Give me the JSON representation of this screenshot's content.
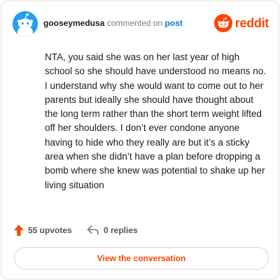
{
  "header": {
    "username": "gooseymedusa",
    "action_text": "commented on",
    "post_link": "post"
  },
  "brand": {
    "wordmark": "reddit",
    "icon": "reddit-alien-logo",
    "color": "#ff4500"
  },
  "comment": {
    "text": "NTA, you said she was on her last year of high school so she should have understood no means no. I understand why she would want to come out to her parents but ideally she should have thought about the long term rather than the short term weight lifted off her shoulders. I don’t ever condone anyone having to hide who they really are but it’s a sticky area when she didn’t have a plan before dropping a bomb where she knew was potential to shake up her living situation"
  },
  "footer": {
    "upvotes_label": "55 upvotes",
    "replies_label": "0 replies",
    "upvote_icon": "upvote-arrow-icon",
    "reply_icon": "reply-arrow-icon"
  },
  "cta": {
    "label": "View the conversation"
  },
  "colors": {
    "accent": "#ff4500",
    "link": "#0079d3",
    "avatar_bg": "#24a0ed"
  }
}
